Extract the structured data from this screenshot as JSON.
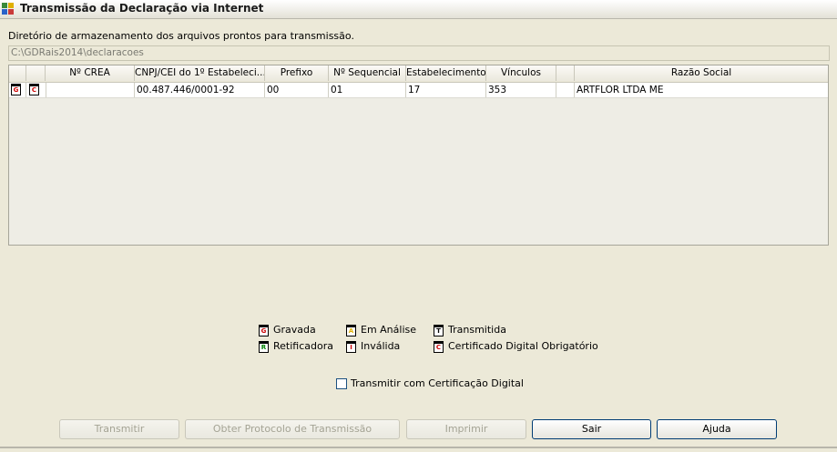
{
  "window": {
    "title": "Transmissão da Declaração via Internet"
  },
  "directory": {
    "label": "Diretório de armazenamento dos arquivos prontos para transmissão.",
    "path": "C:\\GDRais2014\\declaracoes"
  },
  "table": {
    "headers": [
      "Nº CREA",
      "CNPJ/CEI do 1º Estabeleci...",
      "Prefixo",
      "Nº Sequencial",
      "Estabelecimentos",
      "Vínculos",
      "Razão Social"
    ],
    "rows": [
      {
        "status_icon_1": "G",
        "status_icon_2": "C",
        "crea": "",
        "cnpj": "00.487.446/0001-92",
        "prefixo": "00",
        "sequencial": "01",
        "estabelecimentos": "17",
        "vinculos": "353",
        "razao_social": "ARTFLOR LTDA ME"
      }
    ]
  },
  "legend": {
    "gravada": {
      "letter": "G",
      "label": "Gravada",
      "color": "#cc0000"
    },
    "em_analise": {
      "letter": "A",
      "label": "Em Análise",
      "color": "#e0b000"
    },
    "transmitida": {
      "letter": "T",
      "label": "Transmitida",
      "color": "#000000"
    },
    "retificadora": {
      "letter": "R",
      "label": "Retificadora",
      "color": "#008000"
    },
    "invalida": {
      "letter": "I",
      "label": "Inválida",
      "color": "#cc0000"
    },
    "certificado": {
      "letter": "C",
      "label": "Certificado Digital Obrigatório",
      "color": "#cc0000"
    }
  },
  "checkbox": {
    "label": "Transmitir com Certificação Digital",
    "checked": false
  },
  "buttons": {
    "transmitir": "Transmitir",
    "obter_protocolo": "Obter Protocolo de Transmissão",
    "imprimir": "Imprimir",
    "sair": "Sair",
    "ajuda": "Ajuda"
  }
}
